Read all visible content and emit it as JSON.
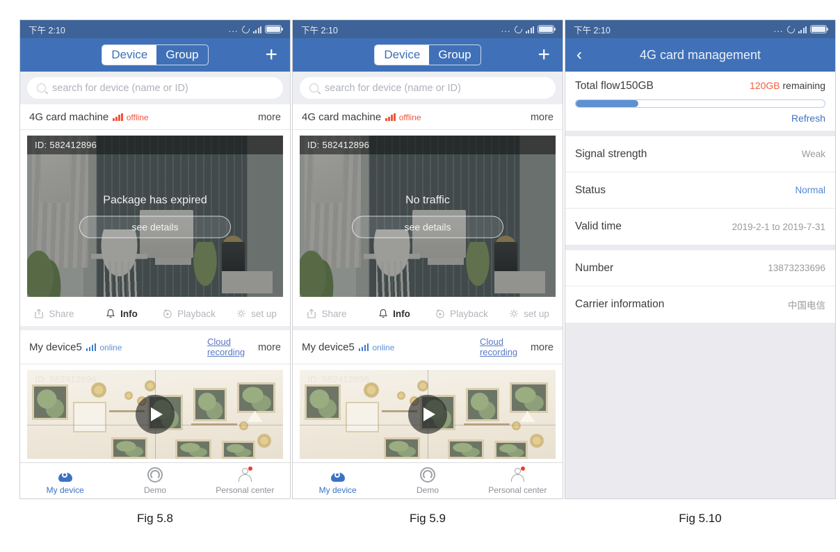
{
  "figures": [
    {
      "caption": "Fig 5.8",
      "type": "device-list",
      "statusbar": {
        "time": "下午 2:10",
        "dots": "...",
        "icons": [
          "spinner-icon",
          "signal-icon",
          "battery-icon"
        ]
      },
      "navbar": {
        "segments": [
          {
            "label": "Device",
            "active": true
          },
          {
            "label": "Group",
            "active": false
          }
        ],
        "add_label": "+"
      },
      "search": {
        "placeholder": "search for device (name or ID)"
      },
      "cards": [
        {
          "name": "4G card machine",
          "state": "offline",
          "state_type": "offline",
          "more": "more",
          "cloud_link": "",
          "video_id": "ID: 582412896",
          "overlay_message": "Package has expired",
          "overlay_button": "see details",
          "actions": [
            {
              "label": "Share",
              "icon": "share-icon",
              "emphasis": false
            },
            {
              "label": "Info",
              "icon": "bell-icon",
              "emphasis": true
            },
            {
              "label": "Playback",
              "icon": "playback-icon",
              "emphasis": false
            },
            {
              "label": "set up",
              "icon": "gear-icon",
              "emphasis": false
            }
          ]
        },
        {
          "name": "My device5",
          "state": "online",
          "state_type": "online",
          "more": "more",
          "cloud_link": "Cloud recording",
          "video_id": "ID: 582412896",
          "overlay_message": "",
          "overlay_button": ""
        }
      ],
      "tabbar": [
        {
          "label": "My device",
          "icon": "camera-icon",
          "active": true,
          "badge": false
        },
        {
          "label": "Demo",
          "icon": "circle-icon",
          "active": false,
          "badge": false
        },
        {
          "label": "Personal center",
          "icon": "person-icon",
          "active": false,
          "badge": true
        }
      ]
    },
    {
      "caption": "Fig 5.9",
      "type": "device-list",
      "statusbar": {
        "time": "下午 2:10",
        "dots": "...",
        "icons": [
          "spinner-icon",
          "signal-icon",
          "battery-icon"
        ]
      },
      "navbar": {
        "segments": [
          {
            "label": "Device",
            "active": true
          },
          {
            "label": "Group",
            "active": false
          }
        ],
        "add_label": "+"
      },
      "search": {
        "placeholder": "search for device (name or ID)"
      },
      "cards": [
        {
          "name": "4G card machine",
          "state": "offline",
          "state_type": "offline",
          "more": "more",
          "cloud_link": "",
          "video_id": "ID: 582412896",
          "overlay_message": "No traffic",
          "overlay_button": "see details",
          "actions": [
            {
              "label": "Share",
              "icon": "share-icon",
              "emphasis": false
            },
            {
              "label": "Info",
              "icon": "bell-icon",
              "emphasis": true
            },
            {
              "label": "Playback",
              "icon": "playback-icon",
              "emphasis": false
            },
            {
              "label": "set up",
              "icon": "gear-icon",
              "emphasis": false
            }
          ]
        },
        {
          "name": "My device5",
          "state": "online",
          "state_type": "online",
          "more": "more",
          "cloud_link": "Cloud recording",
          "video_id": "ID: 582412896",
          "overlay_message": "",
          "overlay_button": ""
        }
      ],
      "tabbar": [
        {
          "label": "My device",
          "icon": "camera-icon",
          "active": true,
          "badge": false
        },
        {
          "label": "Demo",
          "icon": "circle-icon",
          "active": false,
          "badge": false
        },
        {
          "label": "Personal center",
          "icon": "person-icon",
          "active": false,
          "badge": true
        }
      ]
    },
    {
      "caption": "Fig 5.10",
      "type": "card-management",
      "statusbar": {
        "time": "下午 2:10",
        "dots": "...",
        "icons": [
          "spinner-icon",
          "signal-icon",
          "battery-icon"
        ]
      },
      "navbar": {
        "back_icon": "back-chevron-icon",
        "title": "4G card management"
      },
      "flow": {
        "label": "Total flow150GB",
        "remaining_value": "120GB",
        "remaining_suffix": " remaining",
        "progress_percent": 25,
        "refresh_label": "Refresh"
      },
      "rows_group_1": [
        {
          "label": "Signal strength",
          "value": "Weak",
          "accent": false
        },
        {
          "label": "Status",
          "value": "Normal",
          "accent": true
        },
        {
          "label": "Valid time",
          "value": "2019-2-1 to 2019-7-31",
          "accent": false
        }
      ],
      "rows_group_2": [
        {
          "label": "Number",
          "value": "13873233696",
          "accent": false
        },
        {
          "label": "Carrier information",
          "value": "中国电信",
          "accent": false
        }
      ]
    }
  ],
  "colors": {
    "navbar": "#4071b8",
    "statusbar": "#3d6398",
    "accent_blue": "#3b72c4",
    "offline_red": "#f0563c",
    "remaining_orange": "#f0603c",
    "progress_fill": "#5e90d4",
    "page_bg": "#ebebef"
  }
}
